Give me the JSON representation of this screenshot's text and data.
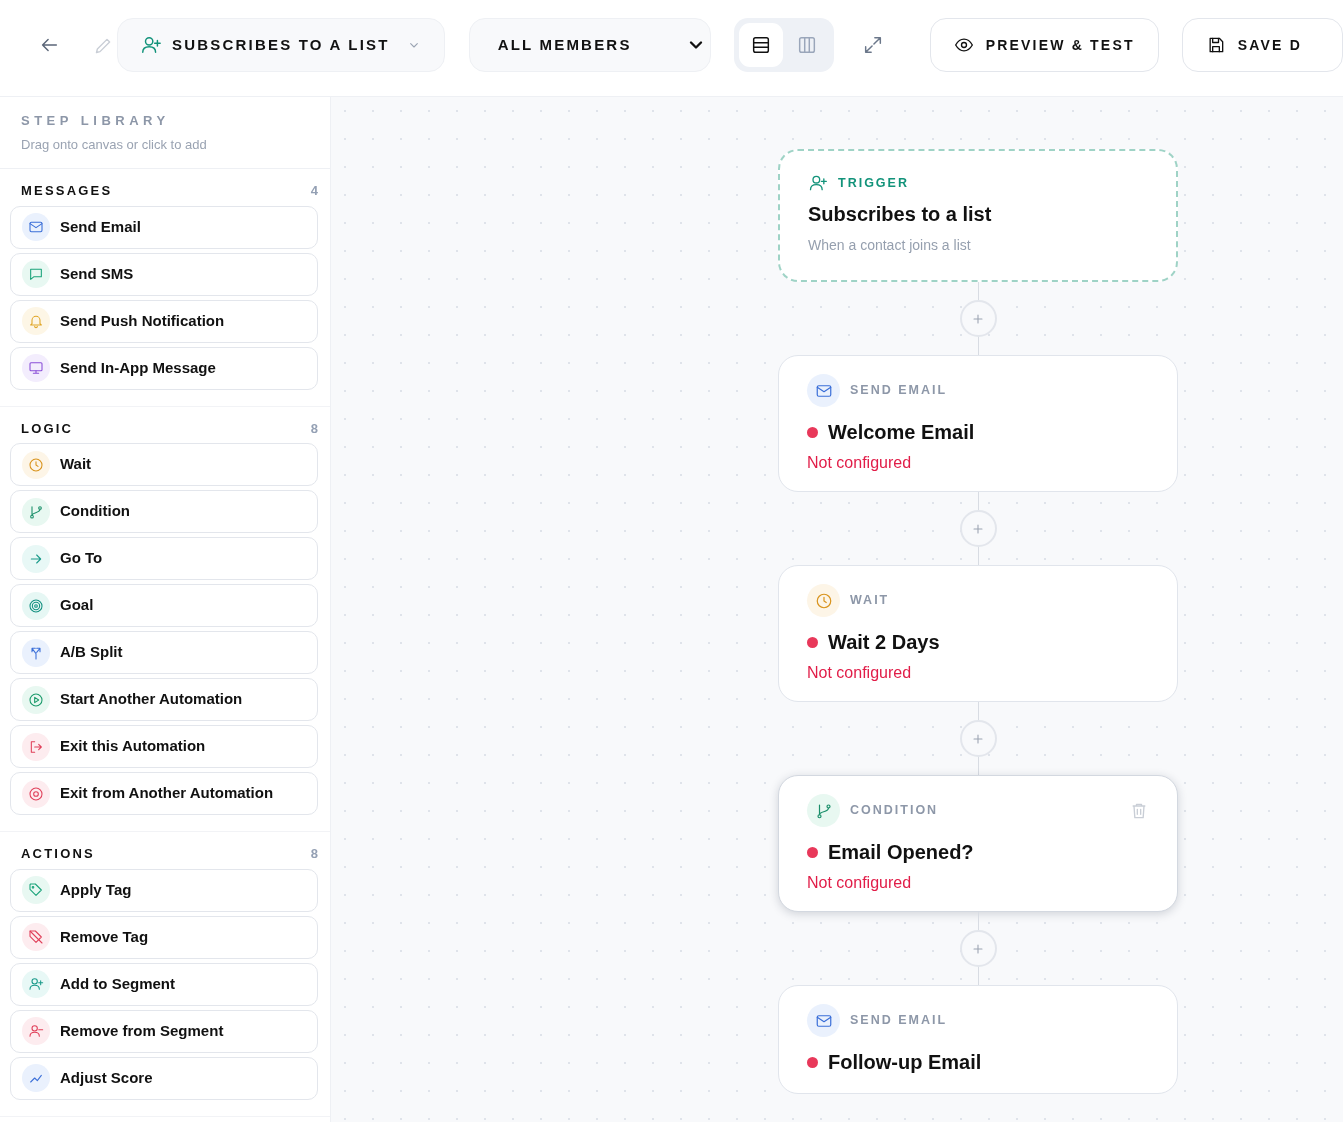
{
  "header": {
    "trigger_select": {
      "label": "SUBSCRIBES TO A LIST"
    },
    "audience_select": {
      "value": "ALL MEMBERS"
    },
    "view_toggle": [
      {
        "kind": "rows",
        "selected": true
      },
      {
        "kind": "columns",
        "selected": false
      }
    ],
    "buttons": [
      {
        "kind": "preview",
        "label": "PREVIEW & TEST"
      },
      {
        "kind": "save",
        "label": "SAVE D"
      }
    ]
  },
  "sidebar": {
    "title": "STEP LIBRARY",
    "subtitle": "Drag onto canvas or click to add",
    "sections": [
      {
        "title": "MESSAGES",
        "count": "4",
        "items": [
          {
            "label": "Send Email",
            "kind": "mail"
          },
          {
            "label": "Send SMS",
            "kind": "sms"
          },
          {
            "label": "Send Push Notification",
            "kind": "bell"
          },
          {
            "label": "Send In-App Message",
            "kind": "monitor"
          }
        ]
      },
      {
        "title": "LOGIC",
        "count": "8",
        "items": [
          {
            "label": "Wait",
            "kind": "clock"
          },
          {
            "label": "Condition",
            "kind": "branch"
          },
          {
            "label": "Go To",
            "kind": "arrow"
          },
          {
            "label": "Goal",
            "kind": "target"
          },
          {
            "label": "A/B Split",
            "kind": "split"
          },
          {
            "label": "Start Another Automation",
            "kind": "play"
          },
          {
            "label": "Exit this Automation",
            "kind": "exit"
          },
          {
            "label": "Exit from Another Automation",
            "kind": "stop"
          }
        ]
      },
      {
        "title": "ACTIONS",
        "count": "8",
        "items": [
          {
            "label": "Apply Tag",
            "kind": "tag"
          },
          {
            "label": "Remove Tag",
            "kind": "tagoff"
          },
          {
            "label": "Add to Segment",
            "kind": "useradd"
          },
          {
            "label": "Remove from Segment",
            "kind": "userremove"
          },
          {
            "label": "Adjust Score",
            "kind": "score"
          }
        ]
      }
    ]
  },
  "canvas": {
    "nodes": [
      {
        "kind": "trigger",
        "tag": "TRIGGER",
        "title": "Subscribes to a list",
        "subtitle": "When a contact joins a list"
      },
      {
        "kind": "mail",
        "tag": "SEND EMAIL",
        "title": "Welcome Email",
        "configured": false,
        "status": "Not configured",
        "selected": false
      },
      {
        "kind": "clock",
        "tag": "WAIT",
        "title": "Wait 2 Days",
        "configured": false,
        "status": "Not configured",
        "selected": false
      },
      {
        "kind": "branch",
        "tag": "CONDITION",
        "title": "Email Opened?",
        "configured": false,
        "status": "Not configured",
        "selected": true
      },
      {
        "kind": "mail",
        "tag": "SEND EMAIL",
        "title": "Follow-up Email",
        "configured": false,
        "selected": false
      }
    ]
  }
}
